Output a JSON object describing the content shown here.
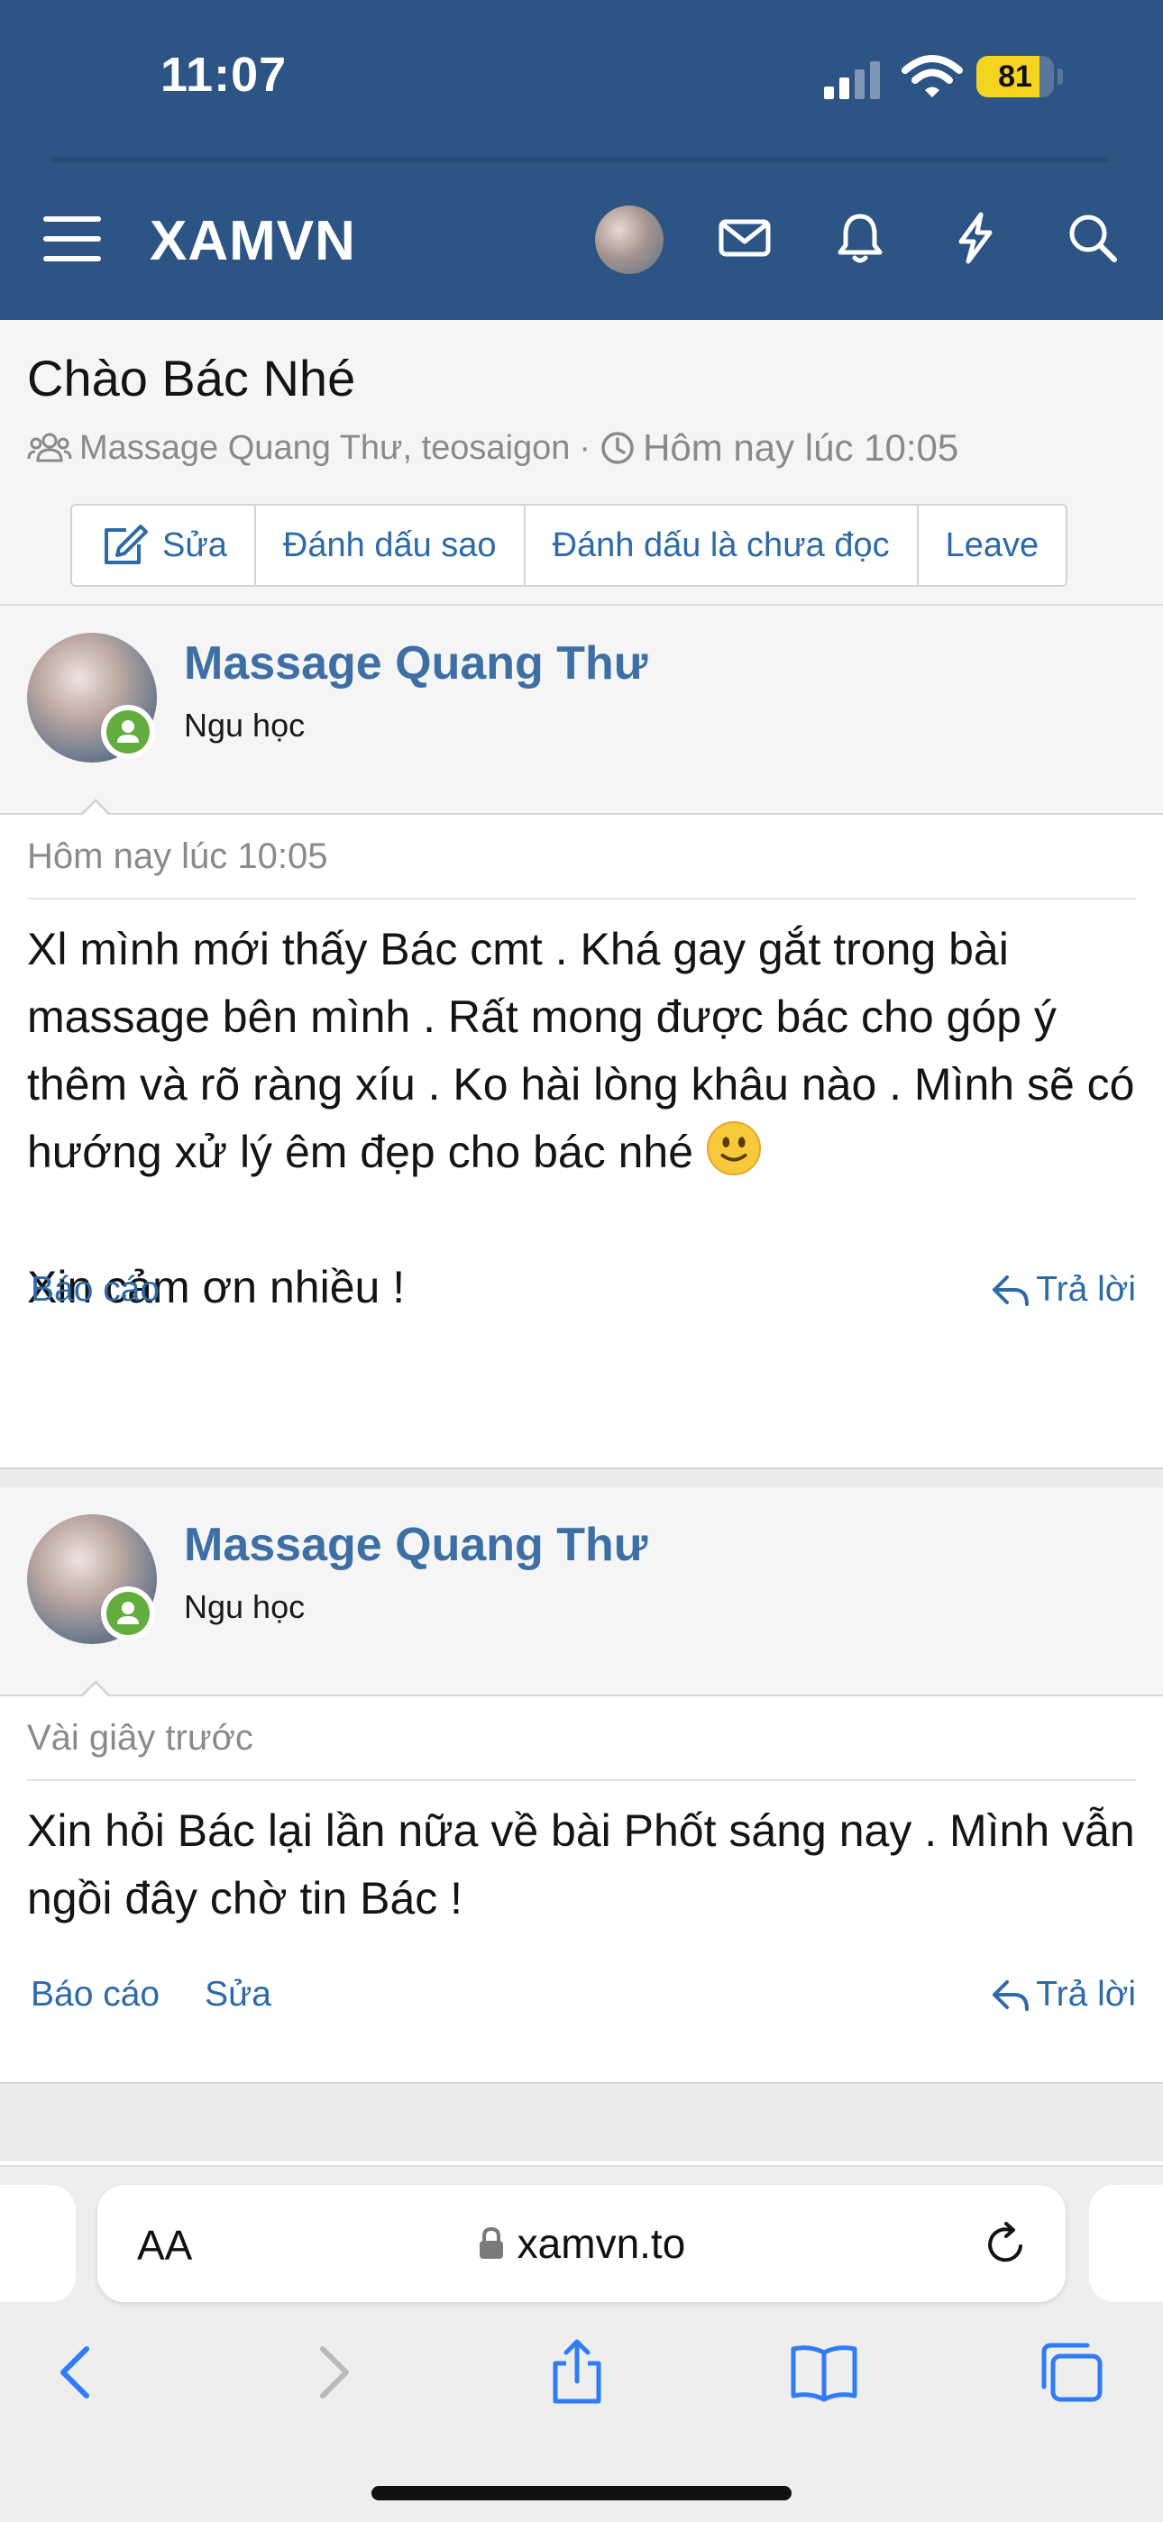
{
  "status_bar": {
    "time": "11:07",
    "battery": "81",
    "battery_level": 0.81
  },
  "nav": {
    "menu_icon": "hamburger-icon",
    "logo": "XAMVN",
    "icons": [
      "avatar",
      "mail-icon",
      "bell-icon",
      "bolt-icon",
      "search-icon"
    ]
  },
  "thread": {
    "title": "Chào Bác Nhé",
    "participants": "Massage Quang Thư, teosaigon",
    "separator": "·",
    "time": "Hôm nay lúc 10:05",
    "actions": {
      "edit": "Sửa",
      "star": "Đánh dấu sao",
      "unread": "Đánh dấu là chưa đọc",
      "leave": "Leave"
    }
  },
  "posts": [
    {
      "username": "Massage Quang Thư",
      "user_title": "Ngu học",
      "date": "Hôm nay lúc 10:05",
      "paragraph1": "Xl mình mới thấy Bác cmt . Khá gay gắt trong bài massage bên mình . Rất mong được bác cho góp ý thêm và rõ ràng xíu . Ko hài lòng khâu nào . Mình sẽ có hướng xử lý êm đẹp cho bác nhé",
      "emoji": "slightly-smiling-face-emoji",
      "paragraph2": "Xin cảm ơn nhiều !",
      "report": "Báo cáo",
      "reply": "Trả lời"
    },
    {
      "username": "Massage Quang Thư",
      "user_title": "Ngu học",
      "date": "Vài giây trước",
      "paragraph1": "Xin hỏi Bác lại lần nữa về bài Phốt sáng nay . Mình vẫn ngồi đây chờ tin Bác !",
      "report": "Báo cáo",
      "edit": "Sửa",
      "reply": "Trả lời"
    }
  ],
  "browser": {
    "text_size": "AA",
    "url": "xamvn.to",
    "toolbar": [
      "back-icon",
      "forward-icon",
      "share-icon",
      "bookmarks-icon",
      "tabs-icon"
    ]
  },
  "colors": {
    "header": "#2c5585",
    "link": "#2d6aa8",
    "username": "#3d6fa4",
    "online": "#63ad3f",
    "battery": "#f5d41f"
  }
}
